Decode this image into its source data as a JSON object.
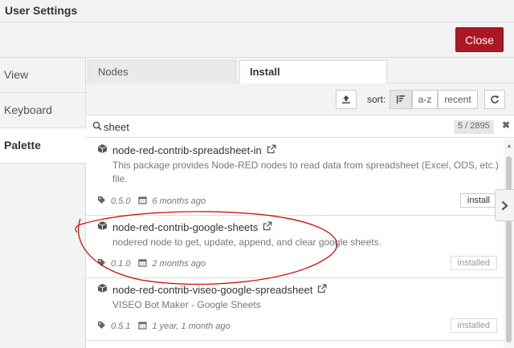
{
  "dialog": {
    "title": "User Settings",
    "close_label": "Close"
  },
  "sidebar": {
    "items": [
      {
        "label": "View"
      },
      {
        "label": "Keyboard"
      },
      {
        "label": "Palette"
      }
    ],
    "active": "Palette"
  },
  "tabs": [
    {
      "label": "Nodes"
    },
    {
      "label": "Install"
    }
  ],
  "toolbar": {
    "sort_label": "sort:",
    "sort_options": [
      "a-z",
      "recent"
    ]
  },
  "search": {
    "value": "sheet",
    "count": "5 / 2895"
  },
  "results": [
    {
      "name": "node-red-contrib-spreadsheet-in",
      "description": "This package provides Node-RED nodes to read data from spreadsheet (Excel, ODS, etc.) file.",
      "version": "0.5.0",
      "updated": "6 months ago",
      "action": "install"
    },
    {
      "name": "node-red-contrib-google-sheets",
      "description": "nodered node to get, update, append, and clear google sheets.",
      "version": "0.1.0",
      "updated": "2 months ago",
      "action": "installed"
    },
    {
      "name": "node-red-contrib-viseo-google-spreadsheet",
      "description": "VISEO Bot Maker - Google Sheets",
      "version": "0.5.1",
      "updated": "1 year, 1 month ago",
      "action": "installed"
    }
  ],
  "colors": {
    "close_button": "#ad1625",
    "annotation": "#cc0000"
  }
}
